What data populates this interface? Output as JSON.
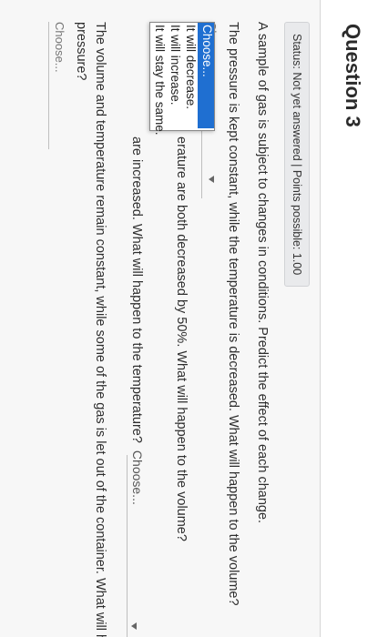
{
  "question": {
    "title": "Question 3",
    "status": "Status: Not yet answered | Points possible: 1.00"
  },
  "prompt": "A sample of gas is subject to changes in conditions. Predict the effect of each change.",
  "parts": [
    {
      "text": "The pressure is kept constant, while the temperature is decreased. What will happen to the volume?",
      "select_value": "Choose..."
    },
    {
      "text_visible": "erature are both decreased by 50%. What will happen to the volume?",
      "select_value": "Choose..."
    },
    {
      "text_visible": "are increased. What will happen to the temperature?",
      "select_value": "Choose..."
    },
    {
      "text": "The volume and temperature remain constant, while some of the gas is let out of the container. What will ha",
      "text_line2": "pressure?",
      "select_value": "Choose..."
    }
  ],
  "dropdown": {
    "options": [
      "Choose...",
      "It will decrease.",
      "It will increase.",
      "It will stay the same."
    ],
    "selected_index": 0
  }
}
